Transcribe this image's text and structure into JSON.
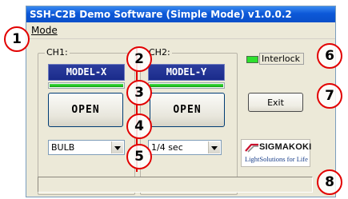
{
  "window": {
    "title": "SSH-C2B Demo Software (Simple Mode) v1.0.0.2"
  },
  "menu": {
    "mode_label": "Mode"
  },
  "ch1": {
    "group_label": "CH1:",
    "model": "MODEL-X",
    "progress": 1.0,
    "open_label": "OPEN",
    "mode_value": "BULB"
  },
  "ch2": {
    "group_label": "CH2:",
    "model": "MODEL-Y",
    "progress": 1.0,
    "open_label": "OPEN",
    "mode_value": "1/4 sec"
  },
  "interlock": {
    "label": "Interlock",
    "state_color": "#2ee02e"
  },
  "exit_label": "Exit",
  "logo": {
    "brand": "SIGMAKOKI",
    "tagline": "LightSolutions for Life"
  },
  "callouts": [
    "1",
    "2",
    "3",
    "4",
    "5",
    "6",
    "7",
    "8"
  ],
  "colors": {
    "accent": "#e20000",
    "model_bar": "#1a2b8a",
    "titlebar": "#0c58d8"
  }
}
